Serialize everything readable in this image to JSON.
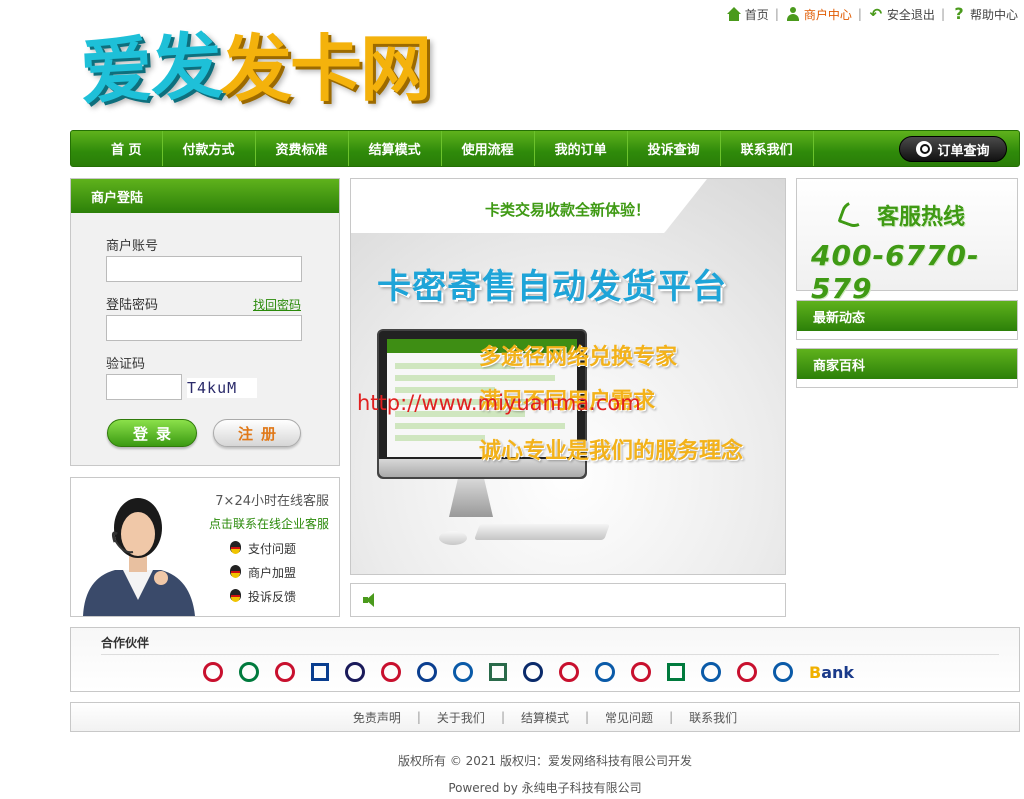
{
  "top_links": {
    "home": "首页",
    "merchant_center": "商户中心",
    "logout": "安全退出",
    "help": "帮助中心"
  },
  "logo": {
    "part1": "爱发",
    "part2": "发卡网"
  },
  "nav": {
    "items": [
      "首 页",
      "付款方式",
      "资费标准",
      "结算模式",
      "使用流程",
      "我的订单",
      "投诉查询",
      "联系我们"
    ],
    "order_query": "订单查询"
  },
  "login": {
    "title": "商户登陆",
    "account_label": "商户账号",
    "account_value": "",
    "password_label": "登陆密码",
    "password_value": "",
    "forgot": "找回密码",
    "captcha_label": "验证码",
    "captcha_value": "",
    "captcha_image_text": "T4kuM",
    "login_button": "登录",
    "register_button": "注册"
  },
  "service": {
    "title": "7×24小时在线客服",
    "link": "点击联系在线企业客服",
    "items": [
      "支付问题",
      "商户加盟",
      "投诉反馈"
    ]
  },
  "banner": {
    "tagline": "卡类交易收款全新体验！",
    "headline": "卡密寄售自动发货平台",
    "sub1": "多途径网络兑换专家",
    "sub2": "满足不同用户需求",
    "sub3": "诚心专业是我们的服务理念",
    "watermark": "http://www.miyuanma.com"
  },
  "hotline": {
    "title": "客服热线",
    "number": "400-6770-579"
  },
  "right_boxes": {
    "news": "最新动态",
    "wiki": "商家百科"
  },
  "partners": {
    "title": "合作伙伴",
    "bank_logo_text1": "B",
    "bank_logo_text2": "ank",
    "colors": [
      "#c8102e",
      "#007a3d",
      "#c8102e",
      "#0a3e8f",
      "#1a1a5a",
      "#c8102e",
      "#0a3e8f",
      "#0a5aa8",
      "#2a6a4a",
      "#0a2a6a",
      "#c8102e",
      "#0a5aa8",
      "#c8102e",
      "#007a3d",
      "#0a5aa8",
      "#c8102e",
      "#0a5aa8"
    ]
  },
  "footer": {
    "links": [
      "免责声明",
      "关于我们",
      "结算模式",
      "常见问题",
      "联系我们"
    ],
    "copyright": "版权所有 © 2021 版权归：爱发网络科技有限公司开发",
    "powered": "Powered by 永纯电子科技有限公司"
  }
}
